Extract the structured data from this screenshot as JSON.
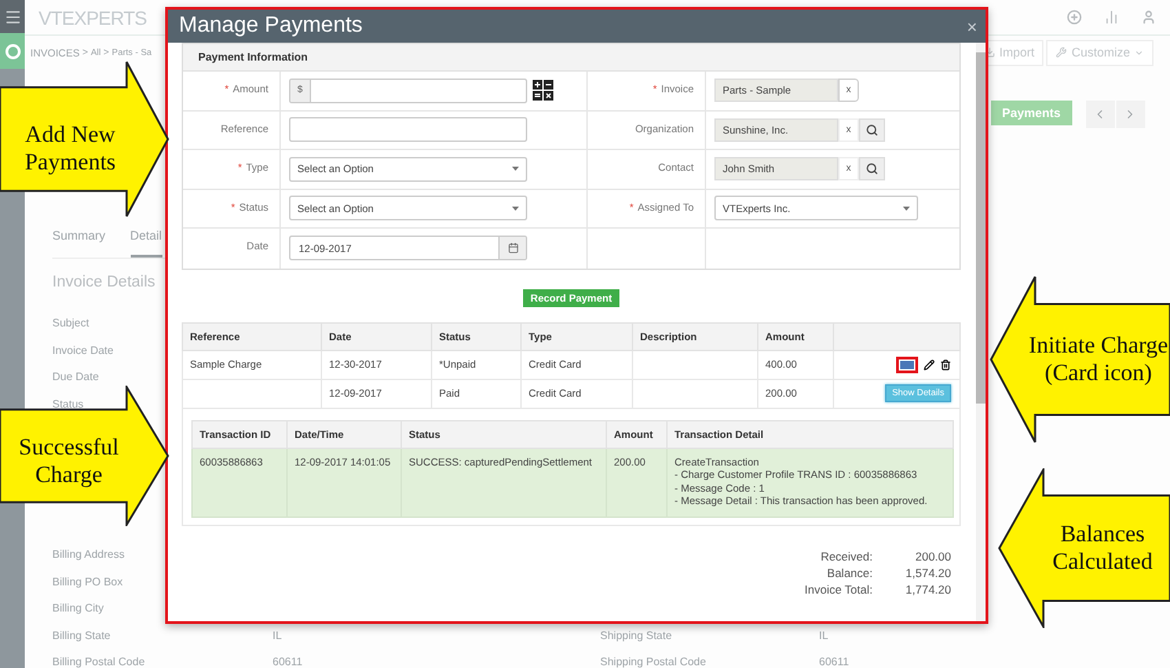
{
  "app": {
    "logo": "VTEXPERTS",
    "breadcrumb": {
      "items": [
        "INVOICES",
        "All",
        "Parts - Sa"
      ],
      "separator": ">"
    },
    "toolbar": [
      "Import",
      "Customize"
    ],
    "payments_button": "Payments",
    "tabs": [
      {
        "label": "Summary",
        "selected": false
      },
      {
        "label": "Detail",
        "selected": true
      }
    ],
    "section_title": "Invoice Details",
    "fields": [
      "Subject",
      "Invoice Date",
      "Due Date",
      "Status"
    ],
    "address_fields": [
      "Billing Address",
      "Billing PO Box",
      "Billing City"
    ],
    "bottom_rows": [
      [
        {
          "label": "Billing State",
          "value": "IL"
        },
        {
          "label": "Shipping State",
          "value": "IL"
        }
      ],
      [
        {
          "label": "Billing Postal Code",
          "value": "60611"
        },
        {
          "label": "Shipping Postal Code",
          "value": "60611"
        }
      ]
    ]
  },
  "modal": {
    "title": "Manage Payments",
    "close": "×",
    "section_title": "Payment Information",
    "required_mark": "*",
    "form_rows": [
      {
        "left": {
          "label": "Amount",
          "required": true,
          "kind": "currency",
          "prefix": "$"
        },
        "right": {
          "label": "Invoice",
          "required": true,
          "kind": "relation",
          "value": "Parts - Sample",
          "clear": "x",
          "searchable": false
        }
      },
      {
        "left": {
          "label": "Reference",
          "required": false,
          "kind": "text"
        },
        "right": {
          "label": "Organization",
          "required": false,
          "kind": "relation",
          "value": "Sunshine, Inc.",
          "clear": "x",
          "searchable": true
        }
      },
      {
        "left": {
          "label": "Type",
          "required": true,
          "kind": "select",
          "value": "Select an Option"
        },
        "right": {
          "label": "Contact",
          "required": false,
          "kind": "relation",
          "value": "John Smith",
          "clear": "x",
          "searchable": true
        }
      },
      {
        "left": {
          "label": "Status",
          "required": true,
          "kind": "select",
          "value": "Select an Option"
        },
        "right": {
          "label": "Assigned To",
          "required": true,
          "kind": "select",
          "value": "VTExperts Inc."
        }
      },
      {
        "left": {
          "label": "Date",
          "required": false,
          "kind": "date",
          "value": "12-09-2017"
        }
      }
    ],
    "record_button": "Record Payment",
    "payments": {
      "columns": [
        "Reference",
        "Date",
        "Status",
        "Type",
        "Description",
        "Amount"
      ],
      "rows": [
        {
          "reference": "Sample Charge",
          "date": "12-30-2017",
          "status": "*Unpaid",
          "type": "Credit Card",
          "amount": "400.00",
          "action": {
            "kind": "charge"
          }
        },
        {
          "date": "12-09-2017",
          "status": "Paid",
          "type": "Credit Card",
          "amount": "200.00",
          "action": {
            "kind": "details",
            "label": "Show Details"
          },
          "details": {
            "columns": [
              "Transaction ID",
              "Date/Time",
              "Status",
              "Amount",
              "Transaction Detail"
            ],
            "rows": [
              {
                "id": "60035886863",
                "datetime": "12-09-2017 14:01:05",
                "status": "SUCCESS: capturedPendingSettlement",
                "amount": "200.00",
                "detail": [
                  "CreateTransaction",
                  "- Charge Customer Profile TRANS ID : 60035886863",
                  "- Message Code : 1",
                  "- Message Detail : This transaction has been approved."
                ]
              }
            ]
          }
        }
      ]
    },
    "totals": [
      {
        "label": "Received:",
        "value": "200.00"
      },
      {
        "label": "Balance:",
        "value": "1,574.20"
      },
      {
        "label": "Invoice Total:",
        "value": "1,774.20"
      }
    ]
  },
  "callouts": [
    {
      "text": "Add New Payments"
    },
    {
      "text": "Successful Charge"
    },
    {
      "text": "Initiate Charge (Card icon)"
    },
    {
      "text": "Balances Calculated"
    }
  ]
}
